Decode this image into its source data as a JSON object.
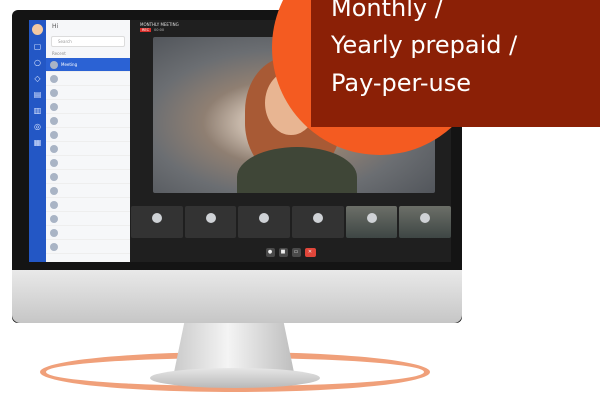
{
  "promo": {
    "lines": [
      "Monthly /",
      "Yearly prepaid /",
      "Pay-per-use"
    ],
    "background_color": "#8b2006",
    "blob_color": "#f45b21"
  },
  "app": {
    "rail_color": "#2357c5",
    "sidebar": {
      "back_label": "Hi",
      "search_placeholder": "Search",
      "section_label": "Recent",
      "items": [
        {
          "name": "Meeting",
          "sub": "",
          "active": true
        },
        {
          "name": "",
          "sub": ""
        },
        {
          "name": "",
          "sub": ""
        },
        {
          "name": "",
          "sub": ""
        },
        {
          "name": "",
          "sub": ""
        },
        {
          "name": "",
          "sub": ""
        },
        {
          "name": "",
          "sub": ""
        },
        {
          "name": "",
          "sub": ""
        },
        {
          "name": "",
          "sub": ""
        },
        {
          "name": "",
          "sub": ""
        },
        {
          "name": "",
          "sub": ""
        },
        {
          "name": "",
          "sub": ""
        },
        {
          "name": "",
          "sub": ""
        },
        {
          "name": "",
          "sub": ""
        }
      ]
    },
    "meeting": {
      "title": "MONTHLY MEETING",
      "rec_label": "REC",
      "time": "00:00",
      "speaker_name": "",
      "tiles": [
        {
          "name": "",
          "camera": false
        },
        {
          "name": "",
          "camera": false
        },
        {
          "name": "",
          "camera": false
        },
        {
          "name": "",
          "camera": false
        },
        {
          "name": "",
          "camera": true
        },
        {
          "name": "",
          "camera": true
        }
      ],
      "controls": [
        "mic-icon",
        "video-icon",
        "share-icon",
        "end-call-icon"
      ]
    }
  }
}
